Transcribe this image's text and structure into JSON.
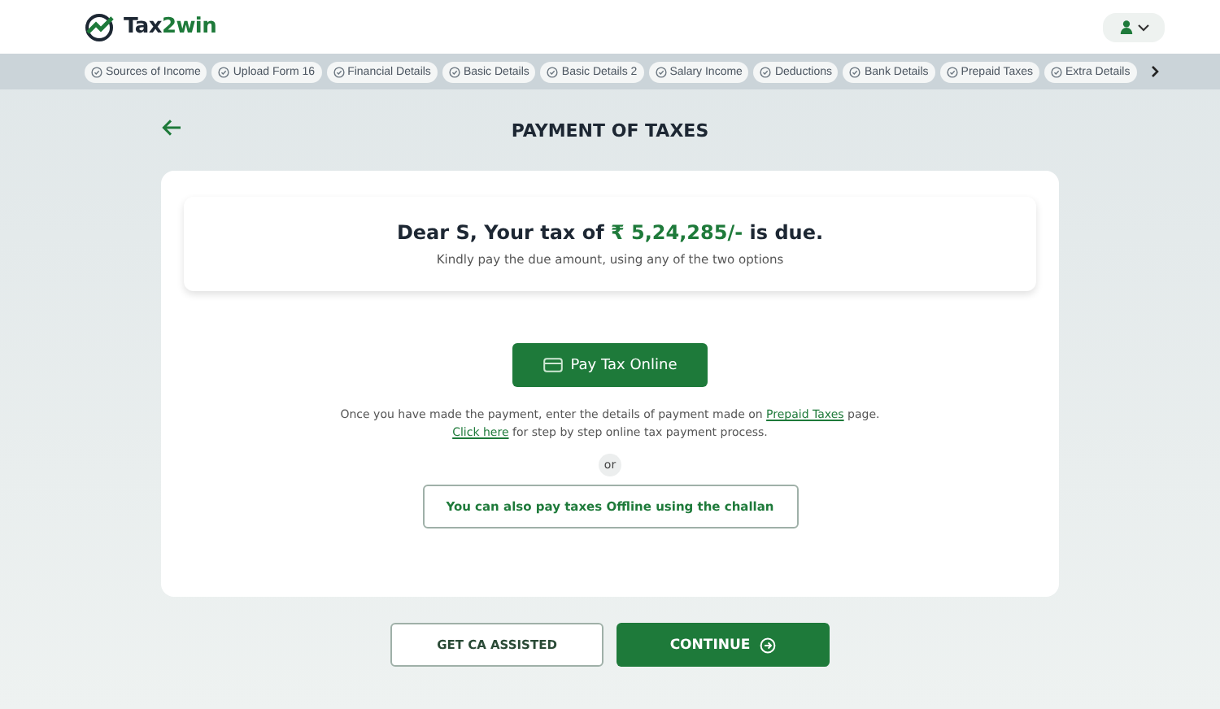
{
  "logo": {
    "text_a": "Tax",
    "text_b": "2win"
  },
  "steps": [
    {
      "label": "Sources of Income"
    },
    {
      "label": "Upload Form 16"
    },
    {
      "label": "Financial Details"
    },
    {
      "label": "Basic Details"
    },
    {
      "label": "Basic Details 2"
    },
    {
      "label": "Salary Income"
    },
    {
      "label": "Deductions"
    },
    {
      "label": "Bank Details"
    },
    {
      "label": "Prepaid Taxes"
    },
    {
      "label": "Extra Details"
    }
  ],
  "page_title": "PAYMENT OF TAXES",
  "due": {
    "before": "Dear S, Your tax of ",
    "amount": "₹ 5,24,285/-",
    "after": " is due.",
    "subtitle": "Kindly pay the due amount, using any of the two options"
  },
  "pay_online_button": "Pay Tax Online",
  "note_1": {
    "before": "Once you have made the payment, enter the details of payment made on ",
    "link": "Prepaid Taxes",
    "after": " page."
  },
  "note_2": {
    "link": "Click here",
    "after": " for step by step online tax payment process."
  },
  "or_label": "or",
  "offline_button": "You can also pay taxes Offline using the challan",
  "ca_button": "GET CA ASSISTED",
  "continue_button": "CONTINUE"
}
